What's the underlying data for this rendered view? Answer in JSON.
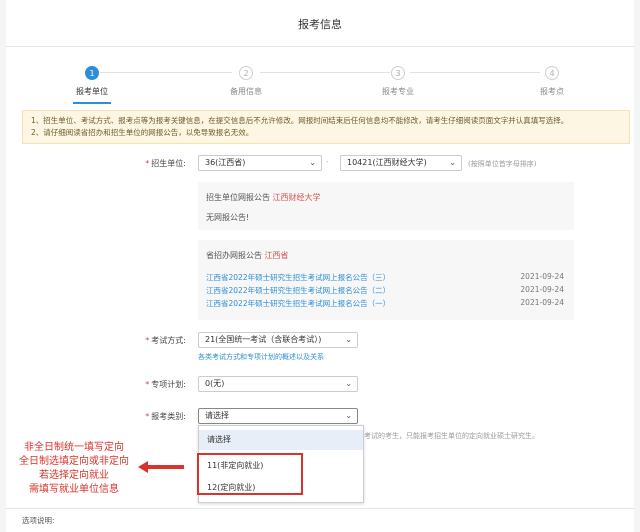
{
  "page": {
    "title": "报考信息"
  },
  "steps": [
    {
      "num": "1",
      "label": "报考单位"
    },
    {
      "num": "2",
      "label": "备用信息"
    },
    {
      "num": "3",
      "label": "报考专业"
    },
    {
      "num": "4",
      "label": "报考点"
    }
  ],
  "notice": {
    "line1": "1、招生单位、考试方式、报考点等为报考关键信息，在提交信息后不允许修改。网报时间结束后任何信息均不能修改，请考生仔细阅读页面文字并认真填写选择。",
    "line2": "2、请仔细阅读省招办和招生单位的网报公告，以免导致报名无效。"
  },
  "form": {
    "unit": {
      "label": "招生单位:",
      "province": "36(江西省)",
      "separator": "-",
      "school": "10421(江西财经大学)",
      "hint": "(按照单位首字母排序)"
    },
    "unit_notice": {
      "title_prefix": "招生单位网报公告",
      "title_link": "江西财经大学",
      "body": "无网报公告!"
    },
    "province_notice": {
      "title_prefix": "省招办网报公告",
      "title_link": "江西省",
      "items": [
        {
          "text": "江西省2022年硕士研究生招生考试网上报名公告（三）",
          "date": "2021-09-24"
        },
        {
          "text": "江西省2022年硕士研究生招生考试网上报名公告（二）",
          "date": "2021-09-24"
        },
        {
          "text": "江西省2022年硕士研究生招生考试网上报名公告（一）",
          "date": "2021-09-24"
        }
      ]
    },
    "exam_mode": {
      "label": "考试方式:",
      "value": "21(全国统一考试（含联合考试）)",
      "hint": "各类考试方式和专项计划的概述以及关系"
    },
    "special_plan": {
      "label": "专项计划:",
      "value": "0(无)"
    },
    "category": {
      "label": "报考类别:",
      "value": "请选择",
      "hint": "考试的考生，只能报考招生单位的定向就业硕士研究生。",
      "options": [
        "请选择",
        "11(非定向就业)",
        "12(定向就业)"
      ]
    }
  },
  "annotation": {
    "lines": [
      "非全日制统一填写定向",
      "全日制选填定向或非定向",
      "若选择定向就业",
      "需填写就业单位信息"
    ]
  },
  "footer": {
    "label": "选项说明:"
  },
  "colors": {
    "accent": "#2c8ed6",
    "annotation": "#d9332b",
    "notice_bg": "#fdf6e3"
  }
}
